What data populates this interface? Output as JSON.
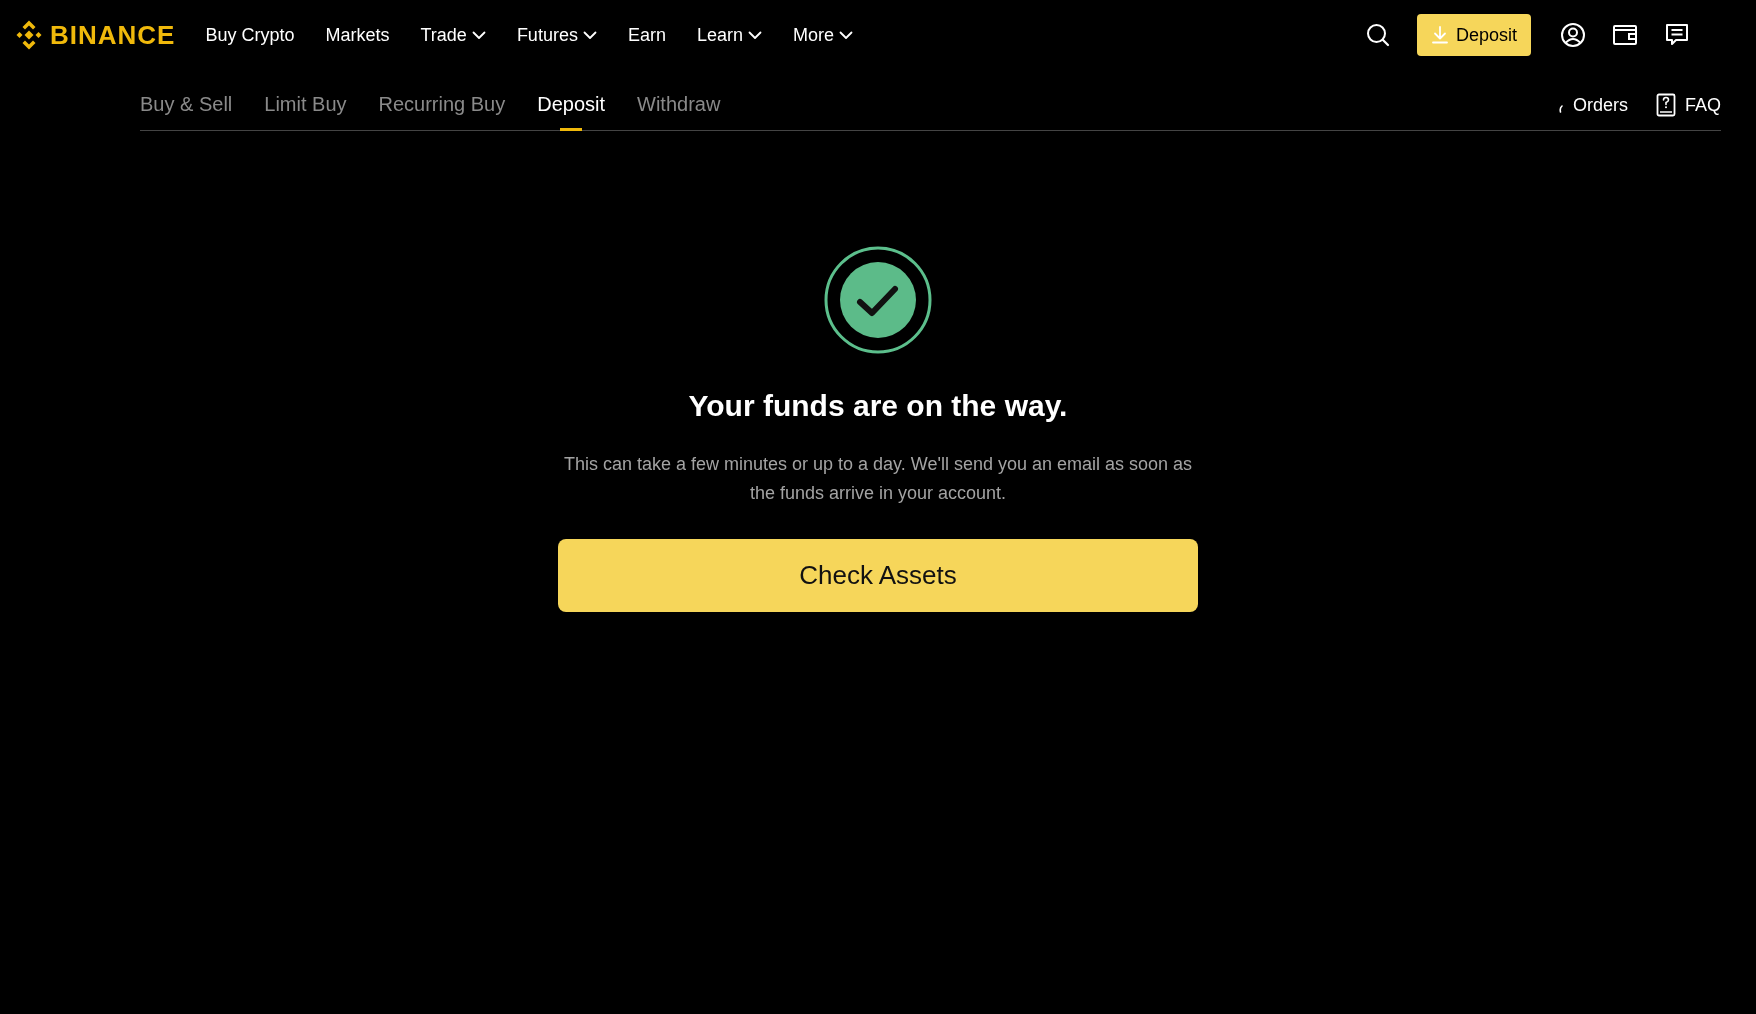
{
  "header": {
    "logo": "BINANCE",
    "nav": [
      {
        "label": "Buy Crypto",
        "dropdown": false
      },
      {
        "label": "Markets",
        "dropdown": false
      },
      {
        "label": "Trade",
        "dropdown": true
      },
      {
        "label": "Futures",
        "dropdown": true
      },
      {
        "label": "Earn",
        "dropdown": false
      },
      {
        "label": "Learn",
        "dropdown": true
      },
      {
        "label": "More",
        "dropdown": true
      }
    ],
    "deposit_button": "Deposit"
  },
  "subnav": {
    "tabs": [
      {
        "label": "Buy & Sell",
        "selected": false
      },
      {
        "label": "Limit Buy",
        "selected": false
      },
      {
        "label": "Recurring Buy",
        "selected": false
      },
      {
        "label": "Deposit",
        "selected": true
      },
      {
        "label": "Withdraw",
        "selected": false
      }
    ],
    "links": [
      {
        "label": "Orders",
        "kind": "orders"
      },
      {
        "label": "FAQ",
        "kind": "faq"
      }
    ]
  },
  "result": {
    "title": "Your funds are on the way.",
    "message": "This can take a few minutes or up to a day. We'll send you an email as soon as the funds arrive in your account.",
    "button": "Check Assets"
  }
}
